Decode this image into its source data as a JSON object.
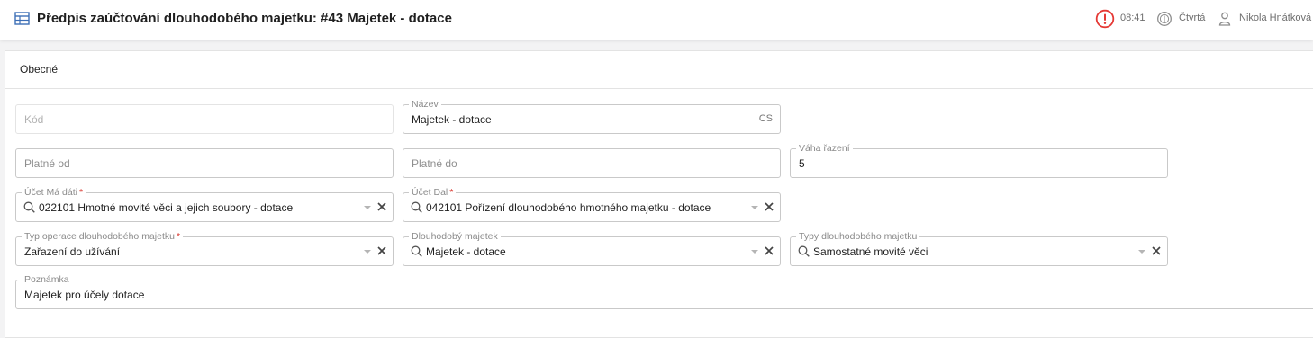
{
  "header": {
    "title": "Předpis zaúčtování dlouhodobého majetku: #43 Majetek - dotace",
    "time": "08:41",
    "company": "Čtvrtá",
    "user": "Nikola Hnátková",
    "icons": {
      "app": "table-icon",
      "alert": "alert-circle-icon",
      "company": "coin-icon",
      "user": "user-icon"
    },
    "alert_color": "#e53935"
  },
  "tabs": {
    "general": "Obecné"
  },
  "form": {
    "code": {
      "placeholder": "Kód",
      "value": ""
    },
    "name": {
      "label": "Název",
      "value": "Majetek - dotace",
      "lang": "CS"
    },
    "valid_from": {
      "placeholder": "Platné od",
      "value": ""
    },
    "valid_to": {
      "placeholder": "Platné do",
      "value": ""
    },
    "sort_weight": {
      "label": "Váha řazení",
      "value": "5"
    },
    "debit_account": {
      "label": "Účet Má dáti",
      "required_mark": "*",
      "value": "022101 Hmotné movité věci a jejich soubory - dotace"
    },
    "credit_account": {
      "label": "Účet Dal",
      "required_mark": "*",
      "value": "042101 Pořízení dlouhodobého hmotného majetku - dotace"
    },
    "operation_type": {
      "label": "Typ operace dlouhodobého majetku",
      "required_mark": "*",
      "value": "Zařazení do užívání"
    },
    "asset": {
      "label": "Dlouhodobý majetek",
      "value": "Majetek - dotace"
    },
    "asset_types": {
      "label": "Typy dlouhodobého majetku",
      "value": "Samostatné movité věci"
    },
    "note": {
      "label": "Poznámka",
      "value": "Majetek pro účely dotace"
    }
  }
}
